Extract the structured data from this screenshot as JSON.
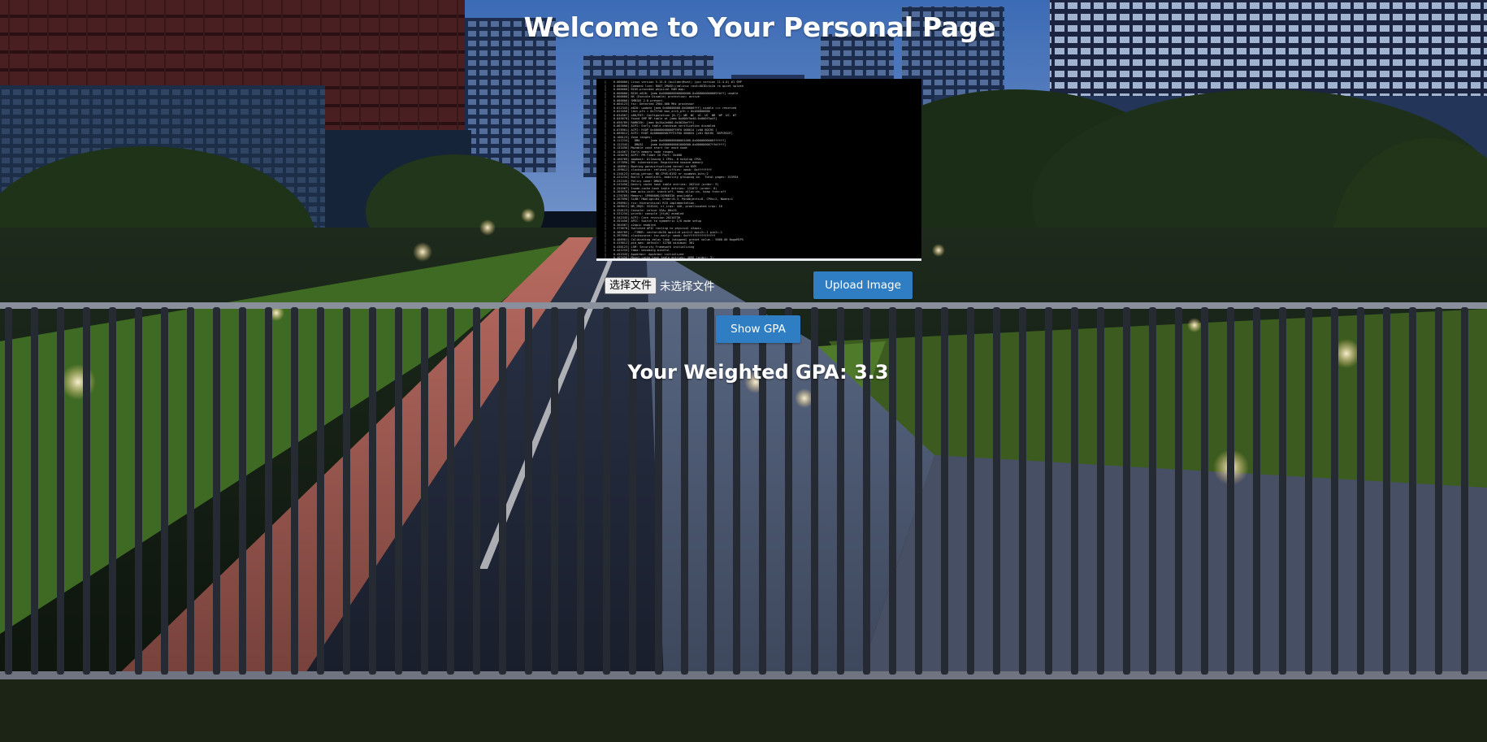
{
  "page": {
    "title": "Welcome to Your Personal Page"
  },
  "upload": {
    "file_button_label": "选择文件",
    "file_status": "未选择文件",
    "upload_button_label": "Upload Image"
  },
  "gpa": {
    "show_button_label": "Show GPA",
    "result_text": "Your Weighted GPA: 3.3"
  },
  "colors": {
    "button_bg": "#2f7dc2",
    "text": "#ffffff",
    "terminal_bg": "#000000"
  },
  "icons": {
    "background": "night-campus-photo",
    "image_preview": "terminal-log-screenshot"
  }
}
